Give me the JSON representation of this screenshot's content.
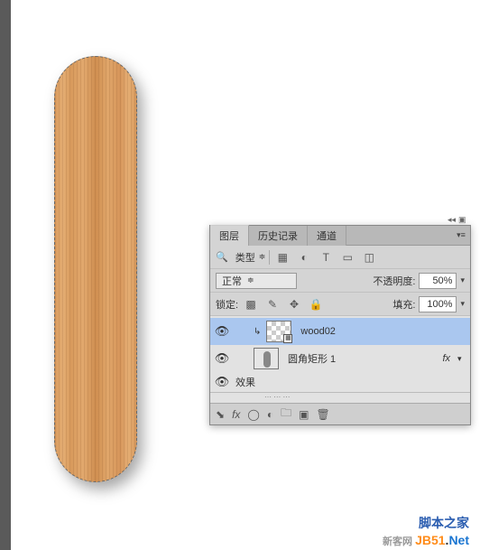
{
  "panel": {
    "tabs": [
      "图层",
      "历史记录",
      "通道"
    ],
    "active_tab": 0,
    "search_label": "类型",
    "blend_mode": "正常",
    "opacity_label": "不透明度:",
    "opacity_value": "50%",
    "lock_label": "锁定:",
    "fill_label": "填充:",
    "fill_value": "100%",
    "layers": [
      {
        "name": "wood02",
        "selected": true,
        "clipped": true,
        "smart": true,
        "visible": true
      },
      {
        "name": "圆角矩形 1",
        "selected": false,
        "clipped": false,
        "shape": true,
        "visible": true,
        "has_fx": true
      }
    ],
    "effects_label": "效果",
    "icon_row": [
      "image",
      "adjust",
      "text",
      "path",
      "shape",
      "smart"
    ]
  },
  "watermark": {
    "line1": "脚本之家",
    "line2_parts": [
      "新客网 ",
      "JB51",
      ".",
      "Net"
    ]
  }
}
